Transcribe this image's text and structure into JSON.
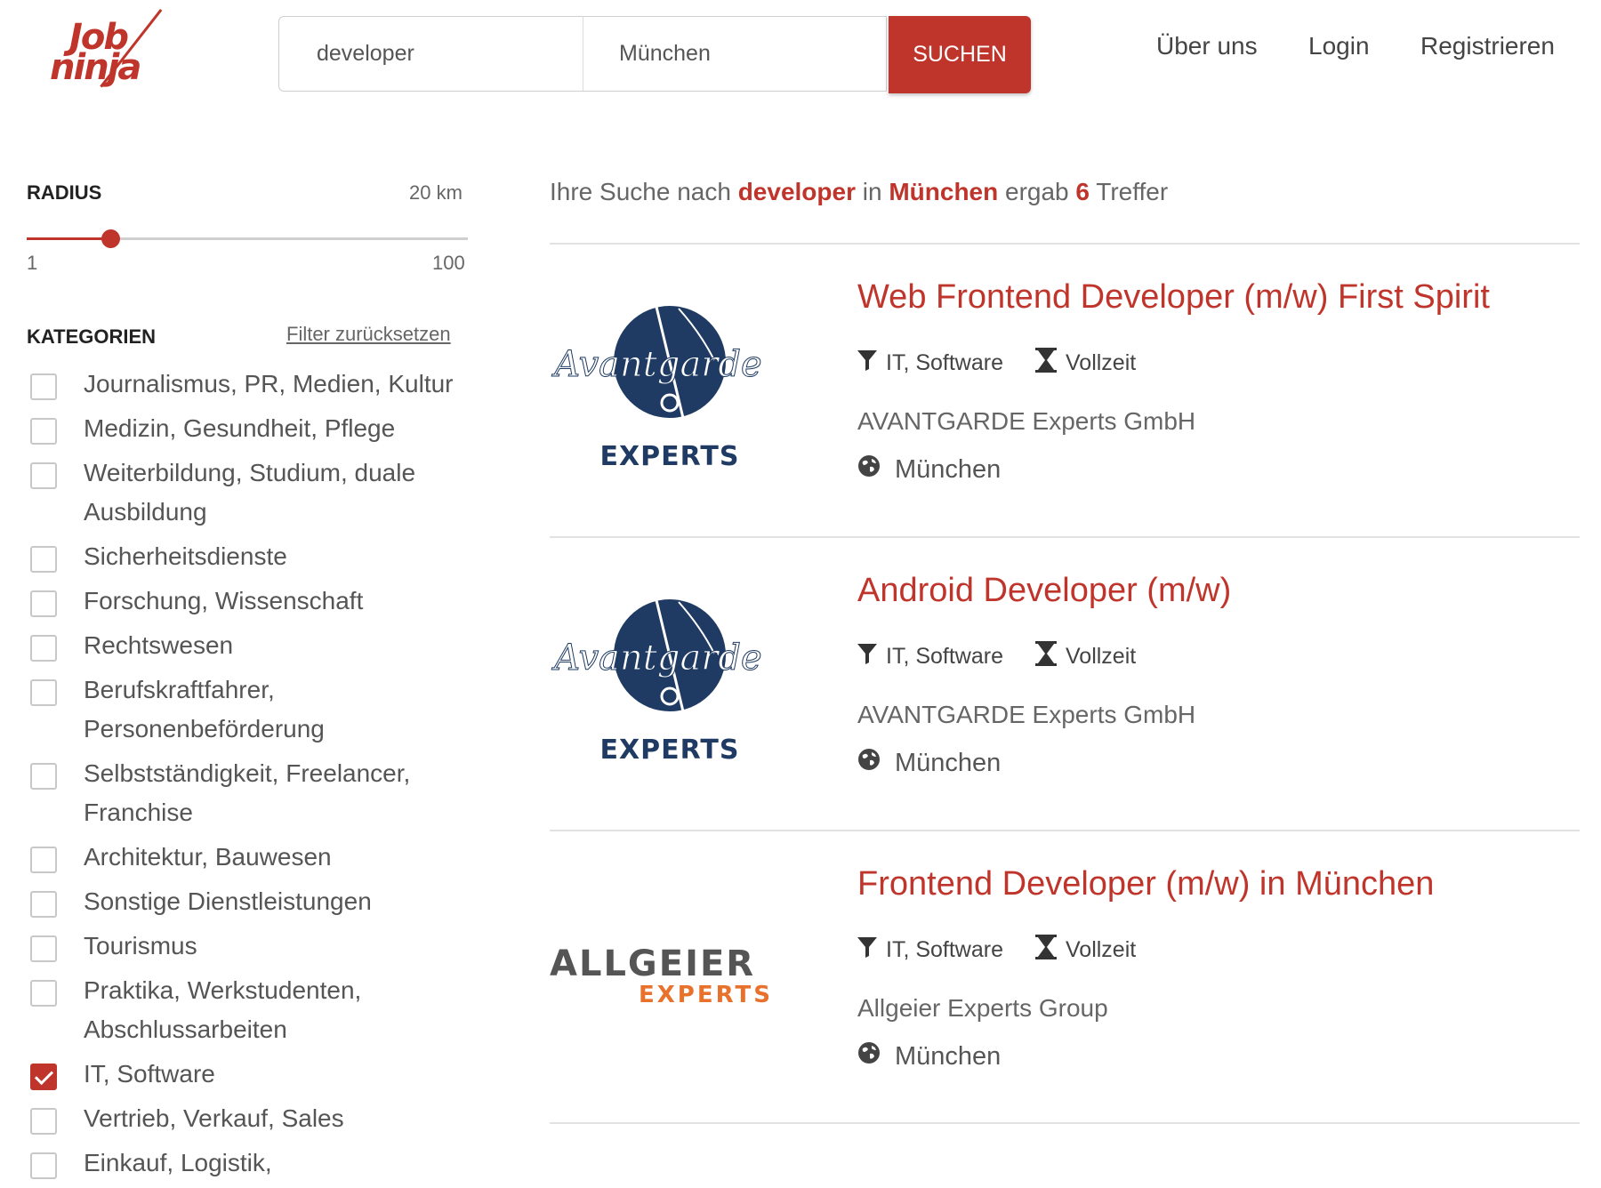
{
  "brand": {
    "logo_line1": "Job",
    "logo_line2": "ninja",
    "accent": "#c0352b"
  },
  "search": {
    "query_value": "developer",
    "location_value": "München",
    "button_label": "SUCHEN"
  },
  "nav": {
    "about": "Über uns",
    "login": "Login",
    "register": "Registrieren"
  },
  "sidebar": {
    "radius_label": "RADIUS",
    "radius_value": "20 km",
    "radius_min": "1",
    "radius_max": "100",
    "radius_fraction": 0.19,
    "categories_label": "KATEGORIEN",
    "reset_label": "Filter zurücksetzen",
    "categories": [
      {
        "label": "Journalismus, PR, Medien, Kultur",
        "checked": false
      },
      {
        "label": "Medizin, Gesundheit, Pflege",
        "checked": false
      },
      {
        "label": "Weiterbildung, Studium, duale Ausbildung",
        "checked": false
      },
      {
        "label": "Sicherheitsdienste",
        "checked": false
      },
      {
        "label": "Forschung, Wissenschaft",
        "checked": false
      },
      {
        "label": "Rechtswesen",
        "checked": false
      },
      {
        "label": "Berufskraftfahrer, Personenbeförderung",
        "checked": false
      },
      {
        "label": "Selbstständigkeit, Freelancer, Franchise",
        "checked": false
      },
      {
        "label": "Architektur, Bauwesen",
        "checked": false
      },
      {
        "label": "Sonstige Dienstleistungen",
        "checked": false
      },
      {
        "label": "Tourismus",
        "checked": false
      },
      {
        "label": "Praktika, Werkstudenten, Abschlussarbeiten",
        "checked": false
      },
      {
        "label": "IT, Software",
        "checked": true
      },
      {
        "label": "Vertrieb, Verkauf, Sales",
        "checked": false
      },
      {
        "label": "Einkauf, Logistik,",
        "checked": false
      }
    ]
  },
  "results": {
    "summary_prefix": "Ihre Suche nach",
    "summary_query": "developer",
    "summary_in": "in",
    "summary_location": "München",
    "summary_result": "ergab",
    "summary_count": "6",
    "summary_suffix": "Treffer",
    "jobs": [
      {
        "title": "Web Frontend Developer (m/w) First Spirit",
        "category": "IT, Software",
        "type": "Vollzeit",
        "company": "AVANTGARDE Experts GmbH",
        "city": "München",
        "logo": "avantgarde",
        "logo_text": "EXPERTS",
        "logo_script": "Avantgarde"
      },
      {
        "title": "Android Developer (m/w)",
        "category": "IT, Software",
        "type": "Vollzeit",
        "company": "AVANTGARDE Experts GmbH",
        "city": "München",
        "logo": "avantgarde",
        "logo_text": "EXPERTS",
        "logo_script": "Avantgarde"
      },
      {
        "title": "Frontend Developer (m/w) in München",
        "category": "IT, Software",
        "type": "Vollzeit",
        "company": "Allgeier Experts Group",
        "city": "München",
        "logo": "allgeier",
        "logo_text": "ALLGEIER",
        "logo_text2": "EXPERTS"
      }
    ]
  }
}
